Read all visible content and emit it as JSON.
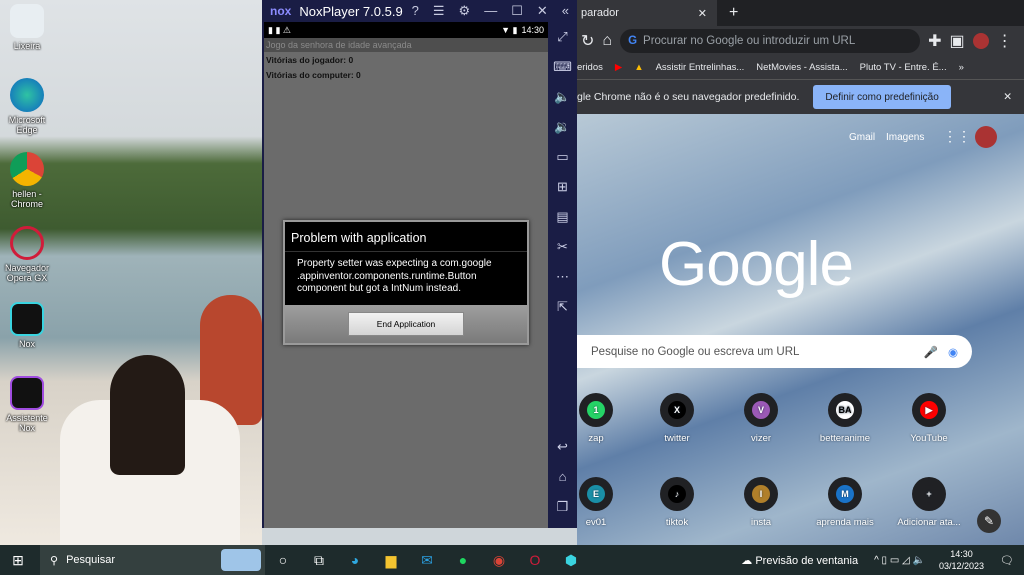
{
  "desktop": {
    "icons": [
      "Lixeira",
      "Microsoft Edge",
      "hellen - Chrome",
      "Navegador Opera GX",
      "Nox",
      "Assistente Nox"
    ]
  },
  "nox": {
    "logo": "nox",
    "title": "NoxPlayer 7.0.5.9",
    "time": "14:30",
    "app_title": "Jogo da senhora de idade avançada",
    "player_wins": "Vitórias do jogador: 0",
    "computer_wins": "Vitórias do computer: 0",
    "dialog": {
      "title": "Problem with application",
      "message": "Property setter was expecting a com.google .appinventor.components.runtime.Button component but got a IntNum instead.",
      "button": "End Application"
    }
  },
  "chrome": {
    "tab": "parador",
    "omnibox_placeholder": "Procurar no Google ou introduzir um URL",
    "bookmarks": [
      "eridos",
      "Assistir Entrelinhas...",
      "NetMovies - Assista...",
      "Pluto TV - Entre. É..."
    ],
    "infobar": {
      "text": "gle Chrome não é o seu navegador predefinido.",
      "button": "Definir como predefinição"
    },
    "gmail": "Gmail",
    "images": "Imagens",
    "logo": "Google",
    "search_placeholder": "Pesquise no Google ou escreva um URL",
    "shortcuts": [
      {
        "label": "zap",
        "letter": "1",
        "color": "#25d366"
      },
      {
        "label": "twitter",
        "letter": "X",
        "color": "#000000"
      },
      {
        "label": "vizer",
        "letter": "V",
        "color": "#9b59b6"
      },
      {
        "label": "betteranime",
        "letter": "BA",
        "color": "#ffffff"
      },
      {
        "label": "YouTube",
        "letter": "▶",
        "color": "#ff0000"
      },
      {
        "label": "ev01",
        "letter": "E",
        "color": "#1a8fa6"
      },
      {
        "label": "tiktok",
        "letter": "♪",
        "color": "#000000"
      },
      {
        "label": "insta",
        "letter": "I",
        "color": "#b07f2a"
      },
      {
        "label": "aprenda mais",
        "letter": "M",
        "color": "#1a73c8"
      },
      {
        "label": "Adicionar ata...",
        "letter": "+",
        "color": "#202124"
      }
    ]
  },
  "taskbar": {
    "search": "Pesquisar",
    "weather": "Previsão de ventania",
    "time": "14:30",
    "date": "03/12/2023"
  }
}
